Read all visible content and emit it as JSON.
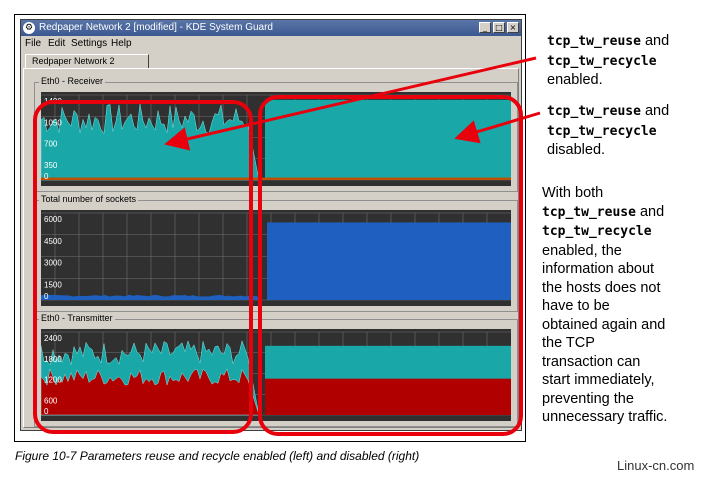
{
  "window": {
    "title": "Redpaper Network 2 [modified] - KDE System Guard",
    "menu": [
      "File",
      "Edit",
      "Settings",
      "Help"
    ],
    "tab": "Redpaper Network 2"
  },
  "graphs": [
    {
      "id": "receiver",
      "label": "Eth0 - Receiver",
      "ticks": [
        "1400",
        "1050",
        "700",
        "350",
        "0"
      ],
      "ymax": 1400,
      "before": {
        "cyan_level": 1000,
        "overlay_level": 40
      },
      "after": {
        "cyan_level": 1320,
        "overlay_level": 40
      }
    },
    {
      "id": "sockets",
      "label": "Total number of sockets",
      "ticks": [
        "6000",
        "4500",
        "3000",
        "1500",
        "0"
      ],
      "ymax": 6000,
      "before": {
        "blue_level": 300
      },
      "after": {
        "blue_level": 5350
      }
    },
    {
      "id": "transmitter",
      "label": "Eth0 - Transmitter",
      "ticks": [
        "2400",
        "1800",
        "1200",
        "600",
        "0"
      ],
      "ymax": 2400,
      "before": {
        "cyan_level": 1800,
        "red_level": 1100
      },
      "after": {
        "cyan_level": 2000,
        "red_level": 1050
      }
    }
  ],
  "annotations": {
    "note1": {
      "code1": "tcp_tw_reuse",
      "and": " and",
      "code2": "tcp_tw_recycle",
      "tail": "enabled."
    },
    "note2": {
      "code1": "tcp_tw_reuse",
      "and": " and",
      "code2": "tcp_tw_recycle",
      "tail": "disabled."
    },
    "note3": {
      "l1": "With both",
      "code1": "tcp_tw_reuse",
      "and": " and",
      "code2": "tcp_tw_recycle",
      "rest": [
        "enabled, the",
        "information about",
        "the hosts does not",
        "have to be",
        "obtained again and",
        "the TCP",
        "transaction can",
        "start immediately,",
        "preventing the",
        "unnecessary traffic."
      ]
    }
  },
  "caption": "Figure 10-7   Parameters reuse and recycle enabled (left) and disabled (right)",
  "watermark": "Linux-cn.com",
  "colors": {
    "cyan": "#1aa7a7",
    "blue": "#1f5fbf",
    "red": "#b00000",
    "orange": "#c05000",
    "grid_bg": "#303030",
    "annotation_red": "#e8000c"
  }
}
